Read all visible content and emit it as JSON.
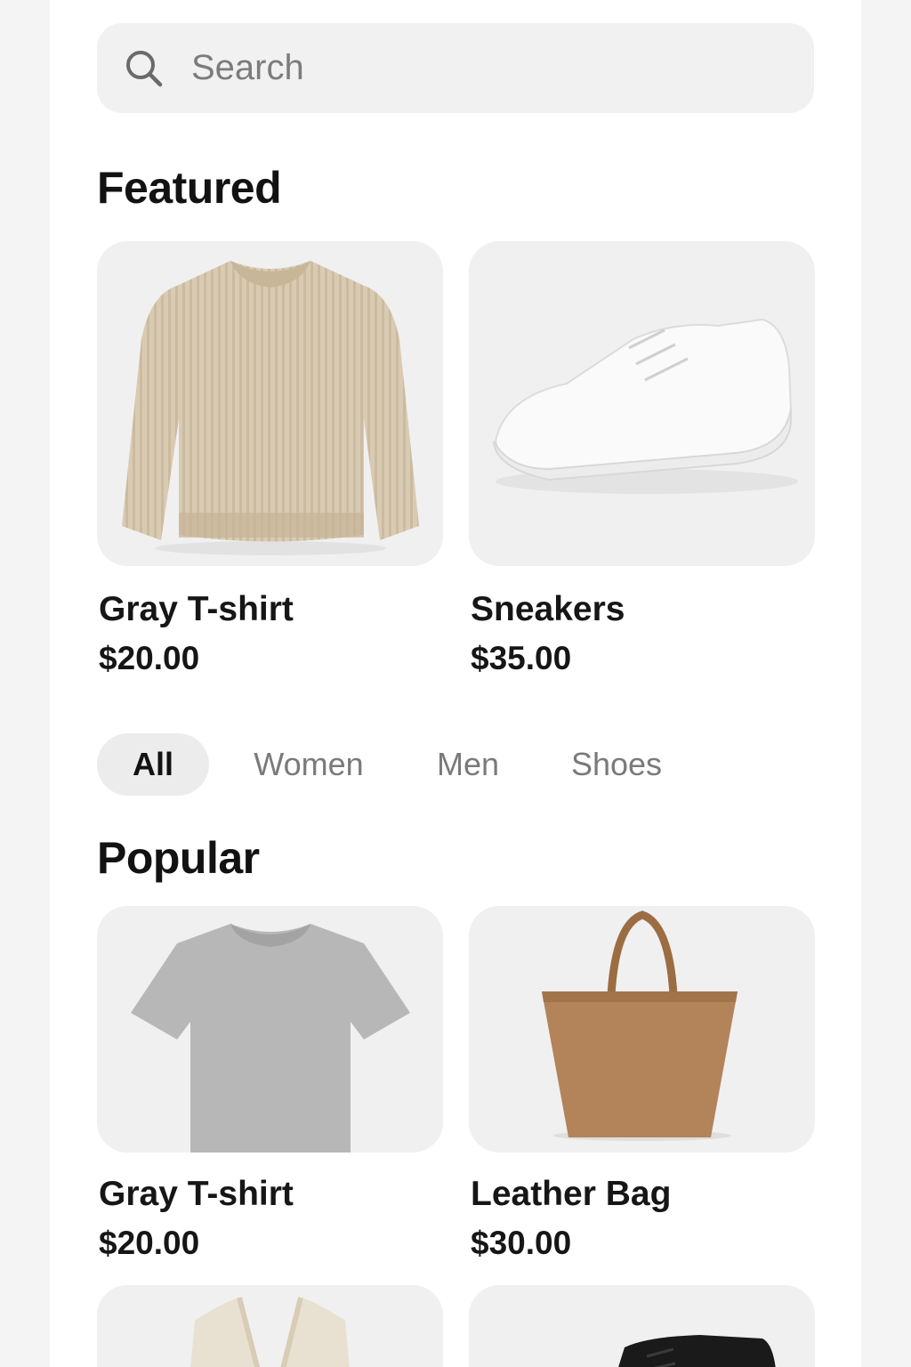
{
  "search": {
    "placeholder": "Search",
    "icon": "search-icon"
  },
  "featured": {
    "title": "Featured",
    "items": [
      {
        "name": "Gray T-shirt",
        "price": "$20.00",
        "image": "beige-sweater"
      },
      {
        "name": "Sneakers",
        "price": "$35.00",
        "image": "white-sneaker"
      }
    ]
  },
  "categories": {
    "selected": "All",
    "items": [
      "All",
      "Women",
      "Men",
      "Shoes"
    ]
  },
  "popular": {
    "title": "Popular",
    "items": [
      {
        "name": "Gray T-shirt",
        "price": "$20.00",
        "image": "gray-tshirt"
      },
      {
        "name": "Leather Bag",
        "price": "$30.00",
        "image": "tan-leather-bag"
      },
      {
        "name": "",
        "price": "",
        "image": "cream-cardigan"
      },
      {
        "name": "",
        "price": "",
        "image": "black-shoe"
      }
    ]
  },
  "colors": {
    "background": "#f4f4f4",
    "card": "#f0f0f0",
    "text": "#151515",
    "muted": "#7a7a7a",
    "chip_active": "#ececec"
  }
}
